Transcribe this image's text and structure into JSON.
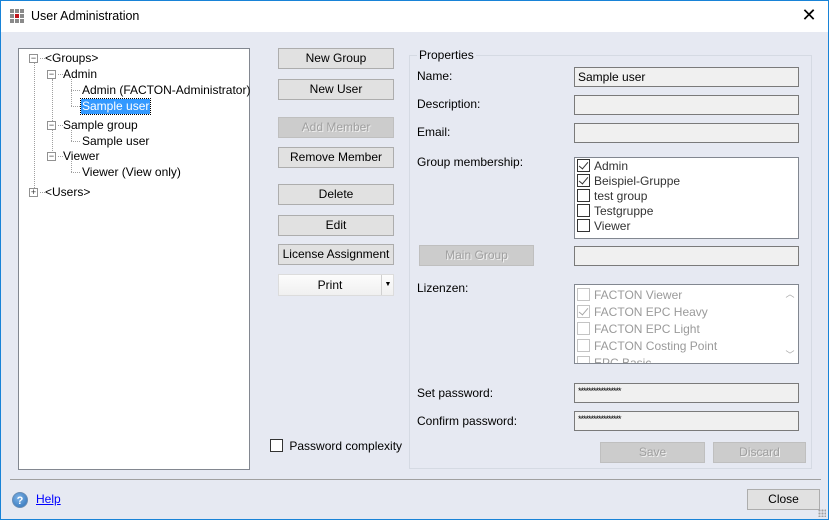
{
  "window": {
    "title": "User Administration",
    "close_icon": "close-icon",
    "app_icon": "grid-app-icon"
  },
  "tree": {
    "groups_root": "<Groups>",
    "users_root": "<Users>",
    "groups": [
      {
        "label": "Admin",
        "children": [
          "Admin (FACTON-Administrator)",
          "Sample user"
        ]
      },
      {
        "label": "Sample group",
        "children": [
          "Sample user"
        ]
      },
      {
        "label": "Viewer",
        "children": [
          "Viewer (View only)"
        ]
      }
    ],
    "selected": "Sample user"
  },
  "actions": {
    "new_group": "New Group",
    "new_user": "New User",
    "add_member": "Add Member",
    "remove_member": "Remove Member",
    "delete": "Delete",
    "edit": "Edit",
    "license_assignment": "License Assignment",
    "print": "Print",
    "print_dropdown_icon": "chevron-down-icon",
    "password_complexity": "Password complexity",
    "password_complexity_checked": false
  },
  "properties": {
    "legend": "Properties",
    "name_label": "Name:",
    "name_value": "Sample user",
    "description_label": "Description:",
    "description_value": "",
    "email_label": "Email:",
    "email_value": "",
    "group_membership_label": "Group membership:",
    "groups": [
      {
        "label": "Admin",
        "checked": true
      },
      {
        "label": "Beispiel-Gruppe",
        "checked": true
      },
      {
        "label": "test group",
        "checked": false
      },
      {
        "label": "Testgruppe",
        "checked": false
      },
      {
        "label": "Viewer",
        "checked": false
      }
    ],
    "main_group_button": "Main Group",
    "main_group_value": "",
    "licenses_label": "Lizenzen:",
    "licenses": [
      {
        "label": "FACTON Viewer",
        "checked": false
      },
      {
        "label": "FACTON EPC Heavy",
        "checked": true
      },
      {
        "label": "FACTON EPC Light",
        "checked": false
      },
      {
        "label": "FACTON Costing Point",
        "checked": false
      },
      {
        "label": "EPC Basic",
        "checked": false
      }
    ],
    "set_password_label": "Set password:",
    "set_password_value": "*****************",
    "confirm_password_label": "Confirm password:",
    "confirm_password_value": "*****************",
    "save": "Save",
    "discard": "Discard"
  },
  "footer": {
    "help": "Help",
    "close": "Close"
  }
}
